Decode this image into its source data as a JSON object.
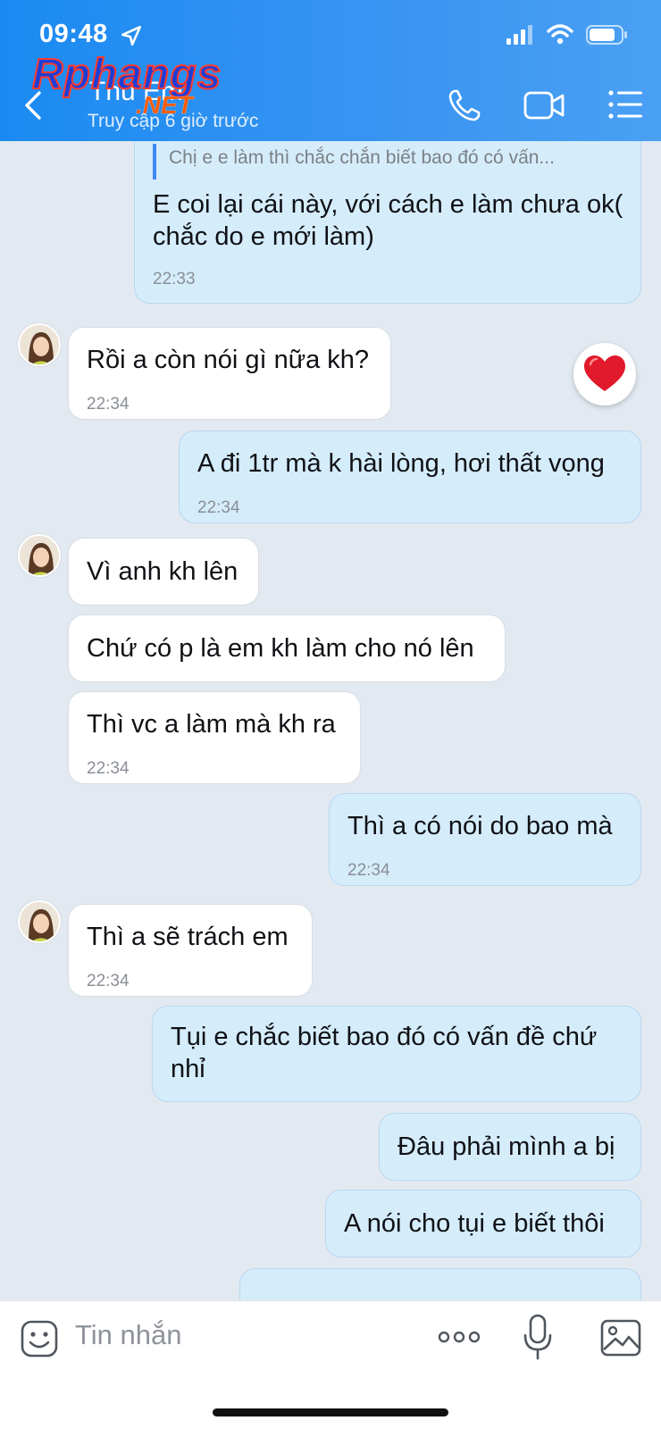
{
  "status_bar": {
    "time": "09:48"
  },
  "header": {
    "contact_name": "Thu Em",
    "last_seen": "Truy cập 6 giờ trước",
    "watermark_top": "Rphangs",
    "watermark_bottom": ".NET"
  },
  "messages": [
    {
      "direction": "out",
      "quote": "Chị e e làm thì chắc chắn biết bao đó có vấn...",
      "text": "E coi lại cái này, với cách e làm chưa ok( chắc do e mới làm)",
      "time": "22:33"
    },
    {
      "direction": "in",
      "text": "Rồi a còn nói gì nữa kh?",
      "time": "22:34",
      "reaction": "heart"
    },
    {
      "direction": "out",
      "text": "A đi 1tr mà k hài lòng, hơi thất vọng",
      "time": "22:34"
    },
    {
      "direction": "in",
      "text": "Vì anh kh lên",
      "time": ""
    },
    {
      "direction": "in",
      "text": "Chứ có p là em kh làm cho nó lên",
      "time": ""
    },
    {
      "direction": "in",
      "text": "Thì vc a làm mà kh ra",
      "time": "22:34"
    },
    {
      "direction": "out",
      "text": "Thì a có nói do bao mà",
      "time": "22:34"
    },
    {
      "direction": "in",
      "text": "Thì a sẽ trách em",
      "time": "22:34"
    },
    {
      "direction": "out",
      "text": "Tụi e chắc biết bao đó có vấn đề chứ nhỉ",
      "time": ""
    },
    {
      "direction": "out",
      "text": "Đâu phải mình a bị",
      "time": ""
    },
    {
      "direction": "out",
      "text": "A nói cho tụi e biết thôi",
      "time": ""
    }
  ],
  "input_bar": {
    "placeholder": "Tin nhắn"
  },
  "colors": {
    "header": "#1a8af2",
    "incoming_bubble": "#ffffff",
    "outgoing_bubble": "#d5ecfb",
    "background": "#e2e9f1",
    "heart": "#e0192b"
  }
}
